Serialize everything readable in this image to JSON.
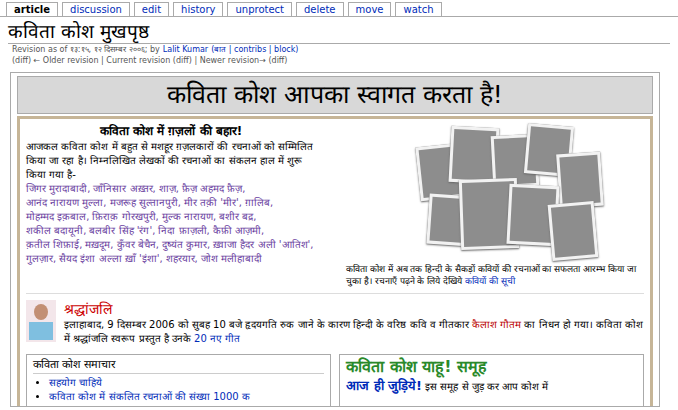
{
  "tabs": [
    {
      "label": "article",
      "selected": true
    },
    {
      "label": "discussion",
      "selected": false
    },
    {
      "label": "edit",
      "selected": false
    },
    {
      "label": "history",
      "selected": false
    },
    {
      "label": "unprotect",
      "selected": false
    },
    {
      "label": "delete",
      "selected": false
    },
    {
      "label": "move",
      "selected": false
    },
    {
      "label": "watch",
      "selected": false
    }
  ],
  "page": {
    "title": "कविता कोश मुखपृष्ठ",
    "revision_prefix": "Revision as of १३:१५, १२ दिसम्बर २००६; by",
    "user": "Lalit Kumar",
    "user_links": "(बात | contribs | block)",
    "nav": "(diff) ← Older revision | Current revision (diff) | Newer revision→ (diff)"
  },
  "banner": "कविता कोश आपका स्वागत करता है!",
  "ghazal": {
    "heading": "कविता कोश में ग़ज़लों की बहार!",
    "intro": "आजकल कविता कोश में बहुत से मशहूर ग़ज़लकारों की रचनाओं को सम्मिलित किया जा रहा है। निम्नलिखित लेखकों की रचनाओं का संकलन हाल में शुरू किया गया है-",
    "poets": [
      "जिगर मुरादाबादी,",
      "जाँनिसार अख़्तर,",
      "शाज़,",
      "फ़ैज़ अहमद फ़ैज़,",
      "आनंद नारायण मुल्ला,",
      "मजरूह सुल्तानपुरी,",
      "मीर तक़ी 'मीर',",
      "ग़ालिब,",
      "मोहम्मद इक़बाल,",
      "फ़िराक़ गोरखपुरी,",
      "मुल्क नारायण,",
      "बशीर बद्र,",
      "शकील बदायूनी,",
      "बलबीर सिंह 'रंग',",
      "निदा फ़ाज़ली,",
      "कैफ़ी आज़मी,",
      "क़तील शिफ़ाई,",
      "मख़दूम,",
      "कुँवर बेचैन,",
      "दुष्यंत कुमार,",
      "ख़्वाजा हैदर अली 'आतिश',",
      "गुलज़ार,",
      "सैयद इंशा अल्ला ख़ाँ 'इंशा',",
      "शहरयार,",
      "जोश मलीहाबादी"
    ]
  },
  "collage": {
    "caption": "कविता कोश में अब तक हिन्दी के सैकड़ों कवियों की रचनाओं का सफलता आरम्भ किया जा चुका है। रचनाएँ पढ़ने के लिये देखिये",
    "caption_link": "कवियों की सूची"
  },
  "tribute": {
    "heading": "श्रद्धांजलि",
    "text_before": "इलाहाबाद, 9 दिसम्बर 2006 को सुबह 10 बजे हृदयगति रुक जाने के कारण हिन्दी के वरिष्ठ कवि व गीतकार",
    "poet_link": "कैलाश गौतम",
    "text_middle": "का निधन हो गया। कविता कोश में श्रद्धांजलि स्वरूप प्रस्तुत है उनके",
    "songs_link": "20 नए गीत"
  },
  "news": {
    "heading": "कविता कोश समाचार",
    "items": [
      "सहयोग चाहिये",
      "कविता कोश में संकलित रचनाओं की संख्या 1000 क"
    ]
  },
  "yahoo": {
    "heading": "कविता कोश याहू! समूह",
    "link": "आज ही जुड़िये!",
    "text": "इस समूह से जुड़ कर आप कोश में"
  }
}
